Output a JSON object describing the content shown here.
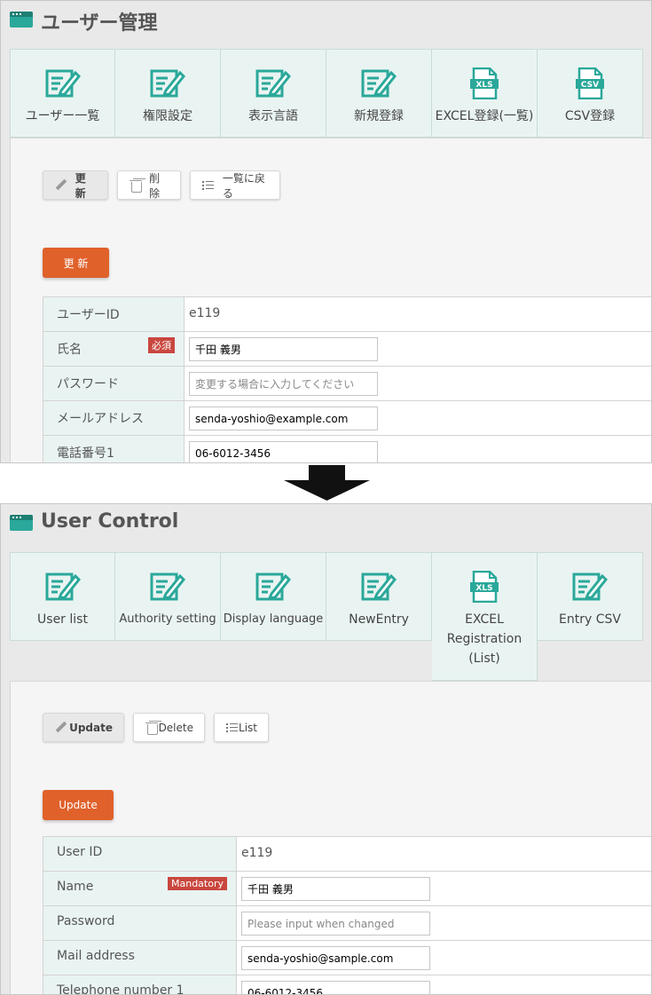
{
  "colors": {
    "accent": "#2aa89a",
    "submit": "#e0612a",
    "required": "#c9473f",
    "label_bg": "#e9f4f2"
  },
  "jp": {
    "title": "ユーザー管理",
    "menu": [
      {
        "label": "ユーザー一覧",
        "icon": "edit-icon"
      },
      {
        "label": "権限設定",
        "icon": "edit-icon"
      },
      {
        "label": "表示言語",
        "icon": "edit-icon"
      },
      {
        "label": "新規登録",
        "icon": "edit-icon"
      },
      {
        "label": "EXCEL登録(一覧)",
        "icon": "xls-file-icon",
        "badge": "XLS"
      },
      {
        "label": "CSV登録",
        "icon": "csv-file-icon",
        "badge": "CSV"
      }
    ],
    "buttons": {
      "update": "更 新",
      "delete": "削 除",
      "list": "一覧に戻る"
    },
    "submit": "更 新",
    "required": "必須",
    "fields": {
      "user_id_label": "ユーザーID",
      "user_id_value": "e119",
      "name_label": "氏名",
      "name_value": "千田 義男",
      "password_label": "パスワード",
      "password_placeholder": "変更する場合に入力してください",
      "mail_label": "メールアドレス",
      "mail_value": "senda-yoshio@example.com",
      "tel_label": "電話番号1",
      "tel_value": "06-6012-3456"
    }
  },
  "en": {
    "title": "User Control",
    "menu": [
      {
        "label": "User list",
        "icon": "edit-icon"
      },
      {
        "label": "Authority setting",
        "icon": "edit-icon"
      },
      {
        "label": "Display language",
        "icon": "edit-icon"
      },
      {
        "label": "NewEntry",
        "icon": "edit-icon"
      },
      {
        "label": "EXCEL Registration (List)",
        "icon": "xls-file-icon",
        "badge": "XLS"
      },
      {
        "label": "Entry CSV",
        "icon": "edit-icon"
      }
    ],
    "buttons": {
      "update": "Update",
      "delete": "Delete",
      "list": "List"
    },
    "submit": "Update",
    "required": "Mandatory",
    "fields": {
      "user_id_label": "User ID",
      "user_id_value": "e119",
      "name_label": "Name",
      "name_value": "千田 義男",
      "password_label": "Password",
      "password_placeholder": "Please input when changed",
      "mail_label": "Mail address",
      "mail_value": "senda-yoshio@sample.com",
      "tel_label": "Telephone number 1",
      "tel_value": "06-6012-3456"
    }
  }
}
